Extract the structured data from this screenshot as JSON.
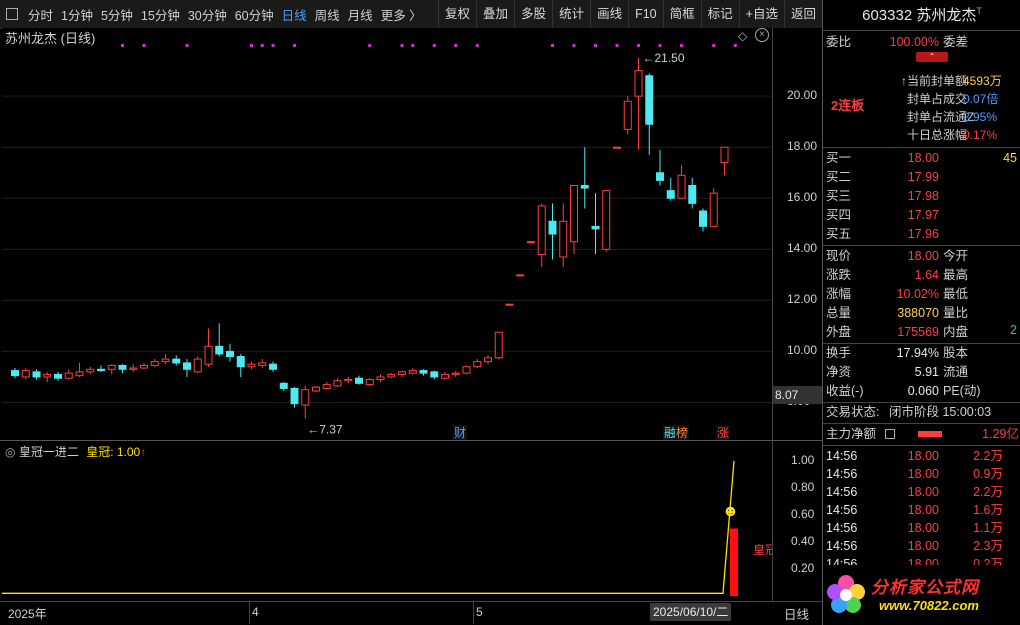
{
  "toolbar": {
    "periods": [
      "分时",
      "1分钟",
      "5分钟",
      "15分钟",
      "30分钟",
      "60分钟",
      "日线",
      "周线",
      "月线",
      "更多 〉"
    ],
    "active_period": "日线",
    "buttons": [
      "复权",
      "叠加",
      "多股",
      "统计",
      "画线",
      "F10",
      "简框",
      "标记",
      "+自选",
      "返回"
    ]
  },
  "chart": {
    "title": "苏州龙杰 (日线)",
    "price_axis": [
      "20.00",
      "18.00",
      "16.00",
      "14.00",
      "12.00",
      "10.00",
      "8.00"
    ],
    "current_price_label": "8.07",
    "high_label": "21.50",
    "low_label": "7.37",
    "event_marks": [
      "财",
      "融",
      "榜",
      "涨"
    ]
  },
  "indicator": {
    "name": "皇冠一进二",
    "series_label": "皇冠:",
    "series_value": "1.00",
    "up_arrow": "↑",
    "axis": [
      "1.00",
      "0.80",
      "0.60",
      "0.40",
      "0.20"
    ],
    "bar_label": "皇冠",
    "smiley": "☻"
  },
  "xaxis": {
    "labels": [
      "2025年",
      "4",
      "5"
    ],
    "date_cursor": "2025/06/10/二",
    "period_button": "日线"
  },
  "quote": {
    "code": "603332",
    "name": "苏州龙杰",
    "name_mark": "T",
    "weibi_label": "委比",
    "weibi_value": "100.00%",
    "weicha_label": "委差",
    "lianban": "2连板",
    "seal_rows": [
      {
        "label": "当前封单额",
        "value": "4593万",
        "color": "yellow",
        "mark": "↑"
      },
      {
        "label": "封单占成交",
        "value": "0.07倍",
        "color": "blue",
        "mark": ""
      },
      {
        "label": "封单占流通Z",
        "value": "2.95%",
        "color": "blue",
        "mark": ""
      },
      {
        "label": "十日总涨幅",
        "value": "0.17%",
        "color": "red",
        "mark": ""
      }
    ],
    "bids": [
      {
        "label": "买一",
        "price": "18.00",
        "vol": "45"
      },
      {
        "label": "买二",
        "price": "17.99",
        "vol": ""
      },
      {
        "label": "买三",
        "price": "17.98",
        "vol": ""
      },
      {
        "label": "买四",
        "price": "17.97",
        "vol": ""
      },
      {
        "label": "买五",
        "price": "17.96",
        "vol": ""
      }
    ],
    "stats": [
      {
        "l": "现价",
        "v": "18.00",
        "vc": "red",
        "r": "今开"
      },
      {
        "l": "涨跌",
        "v": "1.64",
        "vc": "red",
        "r": "最高"
      },
      {
        "l": "涨幅",
        "v": "10.02%",
        "vc": "red",
        "r": "最低"
      },
      {
        "l": "总量",
        "v": "388070",
        "vc": "yellow",
        "r": "量比"
      },
      {
        "l": "外盘",
        "v": "175569",
        "vc": "red",
        "r": "内盘"
      }
    ],
    "neipan_cut": "2",
    "stats2": [
      {
        "l": "换手",
        "v": "17.94%",
        "r": "股本"
      },
      {
        "l": "净资",
        "v": "5.91",
        "r": "流通"
      },
      {
        "l": "收益(-)",
        "v": "0.060",
        "r": "PE(动)"
      }
    ],
    "trade_state_label": "交易状态:",
    "trade_state_value": "闭市阶段 15:00:03",
    "main_flow_label": "主力净额",
    "main_flow_value": "1.29亿",
    "ticks": [
      {
        "t": "14:56",
        "p": "18.00",
        "v": "2.2万"
      },
      {
        "t": "14:56",
        "p": "18.00",
        "v": "0.9万"
      },
      {
        "t": "14:56",
        "p": "18.00",
        "v": "2.2万"
      },
      {
        "t": "14:56",
        "p": "18.00",
        "v": "1.6万"
      },
      {
        "t": "14:56",
        "p": "18.00",
        "v": "1.1万"
      },
      {
        "t": "14:56",
        "p": "18.00",
        "v": "2.3万"
      },
      {
        "t": "14:56",
        "p": "18.00",
        "v": "0.2万"
      }
    ]
  },
  "watermark": {
    "text": "分析家公式网",
    "url": "www.70822.com"
  },
  "colors": {
    "up": "#ff3d3d",
    "down": "#4de8f0",
    "dots": "#d030d0",
    "yellow": "#ffe000"
  },
  "candles": [
    {
      "o": 9.25,
      "c": 9.05,
      "h": 9.35,
      "l": 8.95
    },
    {
      "o": 9.0,
      "c": 9.25,
      "h": 9.35,
      "l": 8.9
    },
    {
      "o": 9.2,
      "c": 9.0,
      "h": 9.3,
      "l": 8.9
    },
    {
      "o": 9.0,
      "c": 9.1,
      "h": 9.2,
      "l": 8.8
    },
    {
      "o": 9.1,
      "c": 8.95,
      "h": 9.2,
      "l": 8.85
    },
    {
      "o": 8.95,
      "c": 9.15,
      "h": 9.3,
      "l": 8.9
    },
    {
      "o": 9.05,
      "c": 9.2,
      "h": 9.55,
      "l": 9.0
    },
    {
      "o": 9.2,
      "c": 9.3,
      "h": 9.4,
      "l": 9.1
    },
    {
      "o": 9.3,
      "c": 9.25,
      "h": 9.45,
      "l": 9.2
    },
    {
      "o": 9.3,
      "c": 9.45,
      "h": 9.5,
      "l": 9.1
    },
    {
      "o": 9.45,
      "c": 9.3,
      "h": 9.5,
      "l": 9.15
    },
    {
      "o": 9.3,
      "c": 9.35,
      "h": 9.5,
      "l": 9.2
    },
    {
      "o": 9.35,
      "c": 9.45,
      "h": 9.55,
      "l": 9.3
    },
    {
      "o": 9.45,
      "c": 9.6,
      "h": 9.7,
      "l": 9.4
    },
    {
      "o": 9.6,
      "c": 9.7,
      "h": 9.9,
      "l": 9.5
    },
    {
      "o": 9.7,
      "c": 9.55,
      "h": 9.85,
      "l": 9.45
    },
    {
      "o": 9.55,
      "c": 9.3,
      "h": 9.7,
      "l": 9.0
    },
    {
      "o": 9.2,
      "c": 9.7,
      "h": 9.8,
      "l": 9.15
    },
    {
      "o": 9.5,
      "c": 10.2,
      "h": 10.9,
      "l": 9.4
    },
    {
      "o": 10.2,
      "c": 9.9,
      "h": 11.1,
      "l": 9.8
    },
    {
      "o": 10.0,
      "c": 9.8,
      "h": 10.3,
      "l": 9.6
    },
    {
      "o": 9.8,
      "c": 9.4,
      "h": 9.9,
      "l": 9.0
    },
    {
      "o": 9.4,
      "c": 9.5,
      "h": 9.6,
      "l": 9.3
    },
    {
      "o": 9.45,
      "c": 9.55,
      "h": 9.7,
      "l": 9.35
    },
    {
      "o": 9.5,
      "c": 9.3,
      "h": 9.6,
      "l": 9.2
    },
    {
      "o": 8.75,
      "c": 8.55,
      "h": 8.8,
      "l": 8.45
    },
    {
      "o": 8.55,
      "c": 7.95,
      "h": 8.6,
      "l": 7.8
    },
    {
      "o": 7.9,
      "c": 8.5,
      "h": 8.65,
      "l": 7.37
    },
    {
      "o": 8.45,
      "c": 8.6,
      "h": 8.65,
      "l": 8.4
    },
    {
      "o": 8.55,
      "c": 8.7,
      "h": 8.8,
      "l": 8.5
    },
    {
      "o": 8.65,
      "c": 8.85,
      "h": 8.95,
      "l": 8.6
    },
    {
      "o": 8.85,
      "c": 8.9,
      "h": 9.0,
      "l": 8.75
    },
    {
      "o": 8.95,
      "c": 8.75,
      "h": 9.05,
      "l": 8.7
    },
    {
      "o": 8.7,
      "c": 8.9,
      "h": 8.95,
      "l": 8.65
    },
    {
      "o": 8.9,
      "c": 9.0,
      "h": 9.1,
      "l": 8.8
    },
    {
      "o": 9.0,
      "c": 9.1,
      "h": 9.15,
      "l": 8.95
    },
    {
      "o": 9.1,
      "c": 9.2,
      "h": 9.25,
      "l": 9.0
    },
    {
      "o": 9.15,
      "c": 9.25,
      "h": 9.35,
      "l": 9.1
    },
    {
      "o": 9.25,
      "c": 9.15,
      "h": 9.3,
      "l": 9.05
    },
    {
      "o": 9.2,
      "c": 9.0,
      "h": 9.25,
      "l": 8.9
    },
    {
      "o": 8.95,
      "c": 9.1,
      "h": 9.2,
      "l": 8.9
    },
    {
      "o": 9.1,
      "c": 9.15,
      "h": 9.25,
      "l": 9.0
    },
    {
      "o": 9.15,
      "c": 9.4,
      "h": 9.45,
      "l": 9.1
    },
    {
      "o": 9.4,
      "c": 9.6,
      "h": 9.7,
      "l": 9.35
    },
    {
      "o": 9.6,
      "c": 9.75,
      "h": 9.85,
      "l": 9.5
    },
    {
      "o": 9.75,
      "c": 10.75,
      "h": 10.75,
      "l": 9.7
    },
    {
      "o": 11.85,
      "c": 11.85,
      "h": 11.85,
      "l": 11.85
    },
    {
      "o": 13.0,
      "c": 13.0,
      "h": 13.0,
      "l": 13.0
    },
    {
      "o": 14.3,
      "c": 14.3,
      "h": 14.3,
      "l": 14.3
    },
    {
      "o": 13.8,
      "c": 15.7,
      "h": 15.8,
      "l": 13.3
    },
    {
      "o": 15.1,
      "c": 14.6,
      "h": 15.8,
      "l": 13.6
    },
    {
      "o": 13.7,
      "c": 15.1,
      "h": 15.8,
      "l": 13.3
    },
    {
      "o": 14.3,
      "c": 16.5,
      "h": 16.5,
      "l": 13.8
    },
    {
      "o": 16.5,
      "c": 16.4,
      "h": 18.0,
      "l": 15.6
    },
    {
      "o": 14.9,
      "c": 14.8,
      "h": 16.2,
      "l": 13.8
    },
    {
      "o": 14.0,
      "c": 16.3,
      "h": 16.3,
      "l": 13.9
    },
    {
      "o": 18.0,
      "c": 18.0,
      "h": 18.0,
      "l": 18.0
    },
    {
      "o": 18.7,
      "c": 19.8,
      "h": 20.0,
      "l": 18.5
    },
    {
      "o": 20.0,
      "c": 21.0,
      "h": 21.5,
      "l": 17.9
    },
    {
      "o": 20.8,
      "c": 18.9,
      "h": 20.9,
      "l": 17.7
    },
    {
      "o": 17.0,
      "c": 16.7,
      "h": 17.9,
      "l": 16.5
    },
    {
      "o": 16.3,
      "c": 16.0,
      "h": 16.8,
      "l": 15.9
    },
    {
      "o": 16.0,
      "c": 16.9,
      "h": 17.3,
      "l": 16.0
    },
    {
      "o": 16.5,
      "c": 15.8,
      "h": 16.8,
      "l": 15.6
    },
    {
      "o": 15.5,
      "c": 14.9,
      "h": 15.6,
      "l": 14.7
    },
    {
      "o": 14.9,
      "c": 16.2,
      "h": 16.4,
      "l": 14.9
    },
    {
      "o": 17.4,
      "c": 18.0,
      "h": 18.0,
      "l": 16.9
    }
  ],
  "dots_at": [
    10,
    12,
    16,
    22,
    23,
    24,
    26,
    33,
    36,
    37,
    39,
    41,
    43,
    50,
    52,
    54,
    56,
    58,
    60,
    62,
    65,
    67
  ]
}
